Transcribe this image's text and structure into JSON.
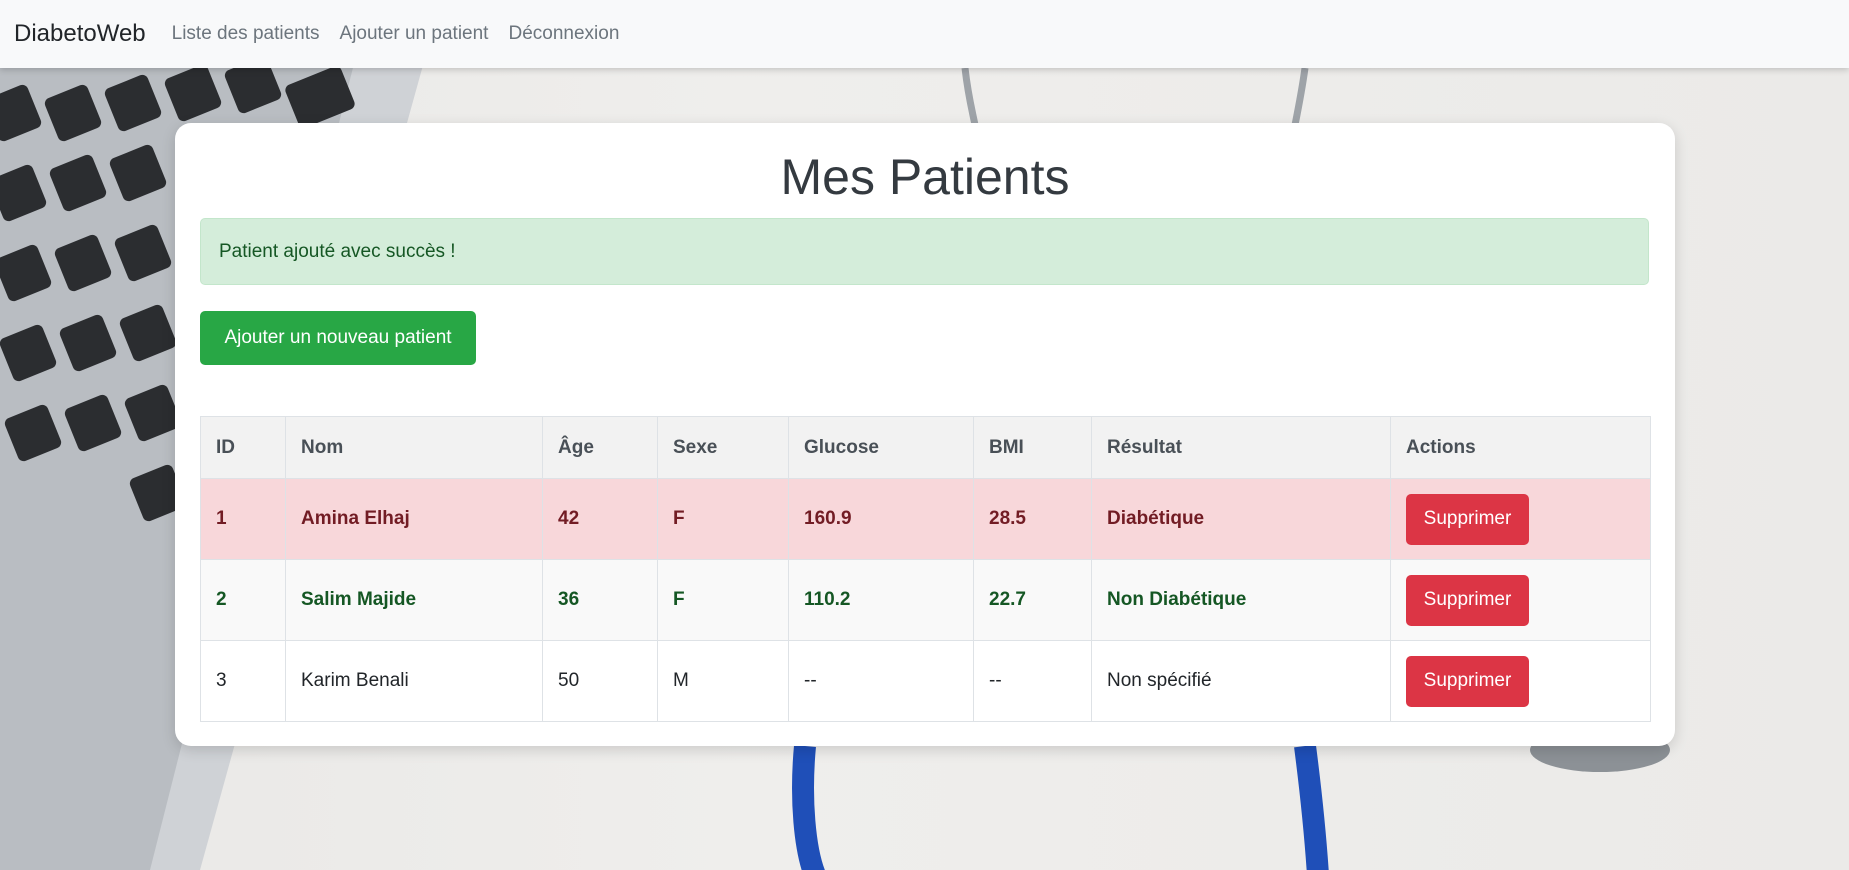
{
  "navbar": {
    "brand": "DiabetoWeb",
    "links": [
      "Liste des patients",
      "Ajouter un patient",
      "Déconnexion"
    ]
  },
  "page": {
    "title": "Mes Patients",
    "alert": "Patient ajouté avec succès !",
    "add_button": "Ajouter un nouveau patient"
  },
  "table": {
    "headers": [
      "ID",
      "Nom",
      "Âge",
      "Sexe",
      "Glucose",
      "BMI",
      "Résultat",
      "Actions"
    ],
    "rows": [
      {
        "id": "1",
        "nom": "Amina Elhaj",
        "age": "42",
        "sexe": "F",
        "glucose": "160.9",
        "bmi": "28.5",
        "resultat": "Diabétique",
        "action": "Supprimer"
      },
      {
        "id": "2",
        "nom": "Salim Majide",
        "age": "36",
        "sexe": "F",
        "glucose": "110.2",
        "bmi": "22.7",
        "resultat": "Non Diabétique",
        "action": "Supprimer"
      },
      {
        "id": "3",
        "nom": "Karim Benali",
        "age": "50",
        "sexe": "M",
        "glucose": "--",
        "bmi": "--",
        "resultat": "Non spécifié",
        "action": "Supprimer"
      }
    ]
  },
  "colors": {
    "navbar_bg": "#f8f9fa",
    "success_alert_bg": "#d4edda",
    "success_alert_text": "#155724",
    "add_button": "#28a745",
    "delete_button": "#dc3545",
    "diabetic_row_bg": "#f8d7da",
    "diabetic_row_text": "#721c24",
    "non_diabetic_row_text": "#155724"
  },
  "icons": {
    "background": "laptop-stethoscope-photo"
  }
}
